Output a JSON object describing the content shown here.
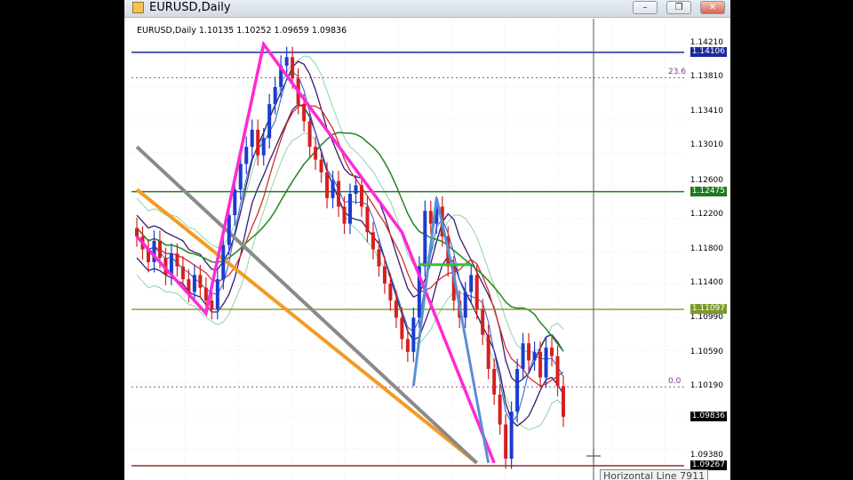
{
  "window": {
    "title": "EURUSD,Daily",
    "info_text": "EURUSD,Daily  1.10135 1.10252 1.09659 1.09836",
    "buttons": [
      "–",
      "❐",
      "✕"
    ]
  },
  "price_axis": {
    "ticks": [
      "1.14210",
      "1.13810",
      "1.13410",
      "1.13010",
      "1.12600",
      "1.12200",
      "1.11800",
      "1.11400",
      "1.10990",
      "1.10590",
      "1.10190",
      "1.09380"
    ],
    "tagged_levels": [
      {
        "label": "1.14106",
        "color": "#1d2a9c"
      },
      {
        "label": "1.12475",
        "color": "#1f7a1f"
      },
      {
        "label": "1.11097",
        "color": "#7c9a2a"
      },
      {
        "label": "1.09836",
        "color": "#000000"
      },
      {
        "label": "1.09267",
        "color": "#000000"
      }
    ]
  },
  "fib_labels": [
    "23.6",
    "0.0"
  ],
  "hline_tooltip": "Horizontal Line 7911",
  "chart_data": {
    "type": "candlestick",
    "symbol": "EURUSD",
    "timeframe": "Daily",
    "ylim": [
      1.091,
      1.145
    ],
    "last_bar": {
      "open": 1.10135,
      "high": 1.10252,
      "low": 1.09659,
      "close": 1.09836
    },
    "closes": [
      1.1195,
      1.118,
      1.1165,
      1.119,
      1.117,
      1.115,
      1.1175,
      1.116,
      1.1145,
      1.113,
      1.115,
      1.1135,
      1.112,
      1.111,
      1.1145,
      1.1185,
      1.122,
      1.125,
      1.128,
      1.13,
      1.132,
      1.129,
      1.131,
      1.135,
      1.137,
      1.1395,
      1.1405,
      1.138,
      1.135,
      1.133,
      1.13,
      1.1285,
      1.127,
      1.124,
      1.126,
      1.123,
      1.121,
      1.1245,
      1.1255,
      1.123,
      1.12,
      1.118,
      1.116,
      1.114,
      1.112,
      1.11,
      1.1075,
      1.106,
      1.11,
      1.116,
      1.1225,
      1.121,
      1.123,
      1.1195,
      1.116,
      1.112,
      1.11,
      1.113,
      1.115,
      1.111,
      1.108,
      1.104,
      1.101,
      1.0975,
      1.0935,
      1.099,
      1.104,
      1.107,
      1.105,
      1.106,
      1.103,
      1.1065,
      1.1055,
      1.102,
      1.0984
    ],
    "horizontal_levels": [
      {
        "value": 1.14106,
        "color": "#1d2a9c"
      },
      {
        "value": 1.12475,
        "color": "#1f7a1f"
      },
      {
        "value": 1.11097,
        "color": "#7c9a2a"
      },
      {
        "value": 1.09267,
        "color": "#8b1a1a"
      }
    ],
    "fibonacci": [
      {
        "label": "23.6",
        "value": 1.1381
      },
      {
        "label": "0.0",
        "value": 1.1019
      }
    ],
    "zigzag": [
      [
        0,
        1.1195
      ],
      [
        12,
        1.1105
      ],
      [
        22,
        1.142
      ],
      [
        46,
        1.12
      ],
      [
        62,
        1.093
      ]
    ],
    "trendlines": [
      {
        "color": "#f59a23",
        "from": [
          0,
          1.125
        ],
        "to": [
          47,
          1.093
        ]
      },
      {
        "color": "#8a8a8a",
        "from": [
          0,
          1.13
        ],
        "to": [
          47,
          1.093
        ]
      }
    ]
  }
}
